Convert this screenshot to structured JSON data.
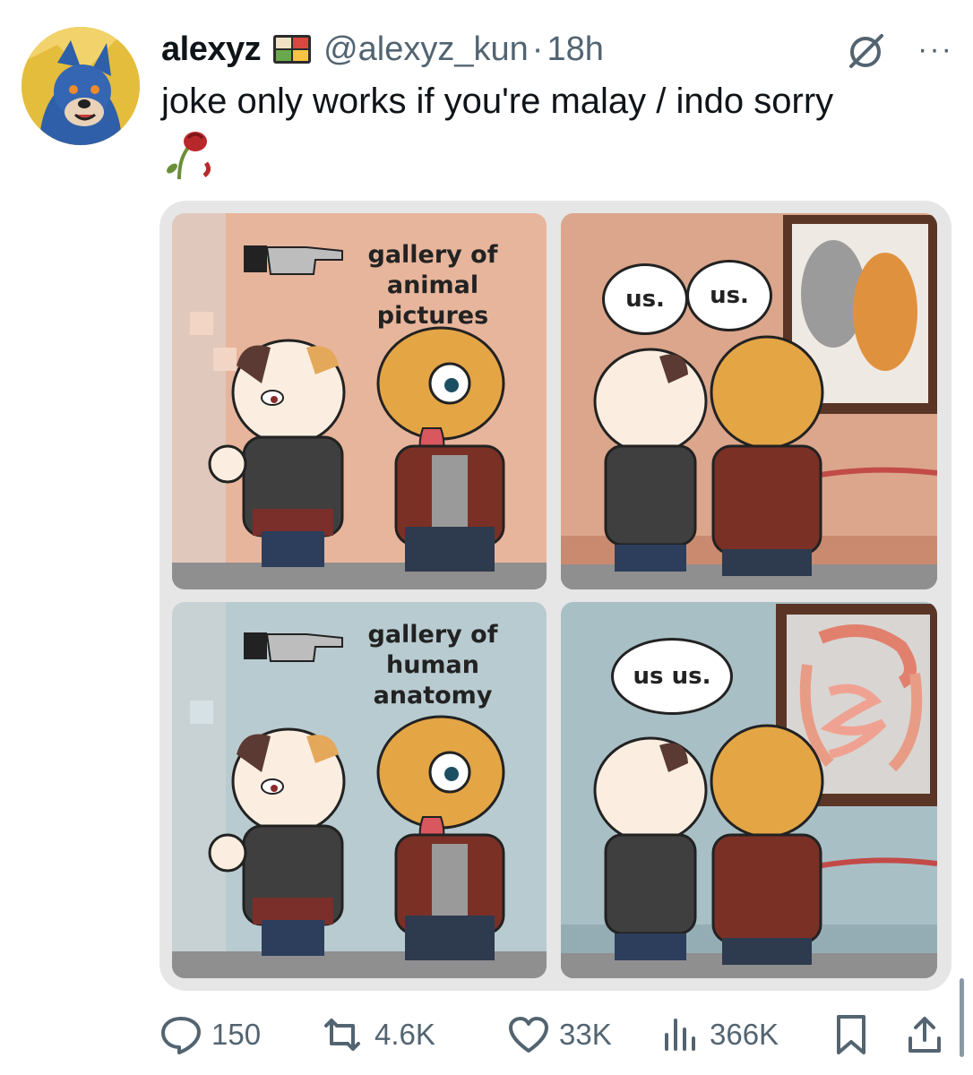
{
  "tweet": {
    "display_name": "alexyz",
    "handle": "@alexyz_kun",
    "separator": "·",
    "time": "18h",
    "text": "joke only works if you're malay / indo sorry",
    "more_label": "···"
  },
  "comic": {
    "panel1_caption_line1": "gallery of",
    "panel1_caption_line2": "animal pictures",
    "panel2_bubble_left": "us.",
    "panel2_bubble_right": "us.",
    "panel3_caption_line1": "gallery of",
    "panel3_caption_line2": "human anatomy",
    "panel4_bubble": "us us."
  },
  "actions": {
    "replies": "150",
    "reposts": "4.6K",
    "likes": "33K",
    "views": "366K"
  },
  "colors": {
    "accent_text": "#0f1419",
    "secondary_text": "#536471",
    "media_border": "#e6e6e6"
  },
  "icons": {
    "reply": "reply-icon",
    "repost": "repost-icon",
    "like": "heart-icon",
    "views": "views-icon",
    "bookmark": "bookmark-icon",
    "share": "share-icon",
    "grok": "grok-icon",
    "badge": "bento-box-icon",
    "rose": "wilted-rose-icon"
  }
}
